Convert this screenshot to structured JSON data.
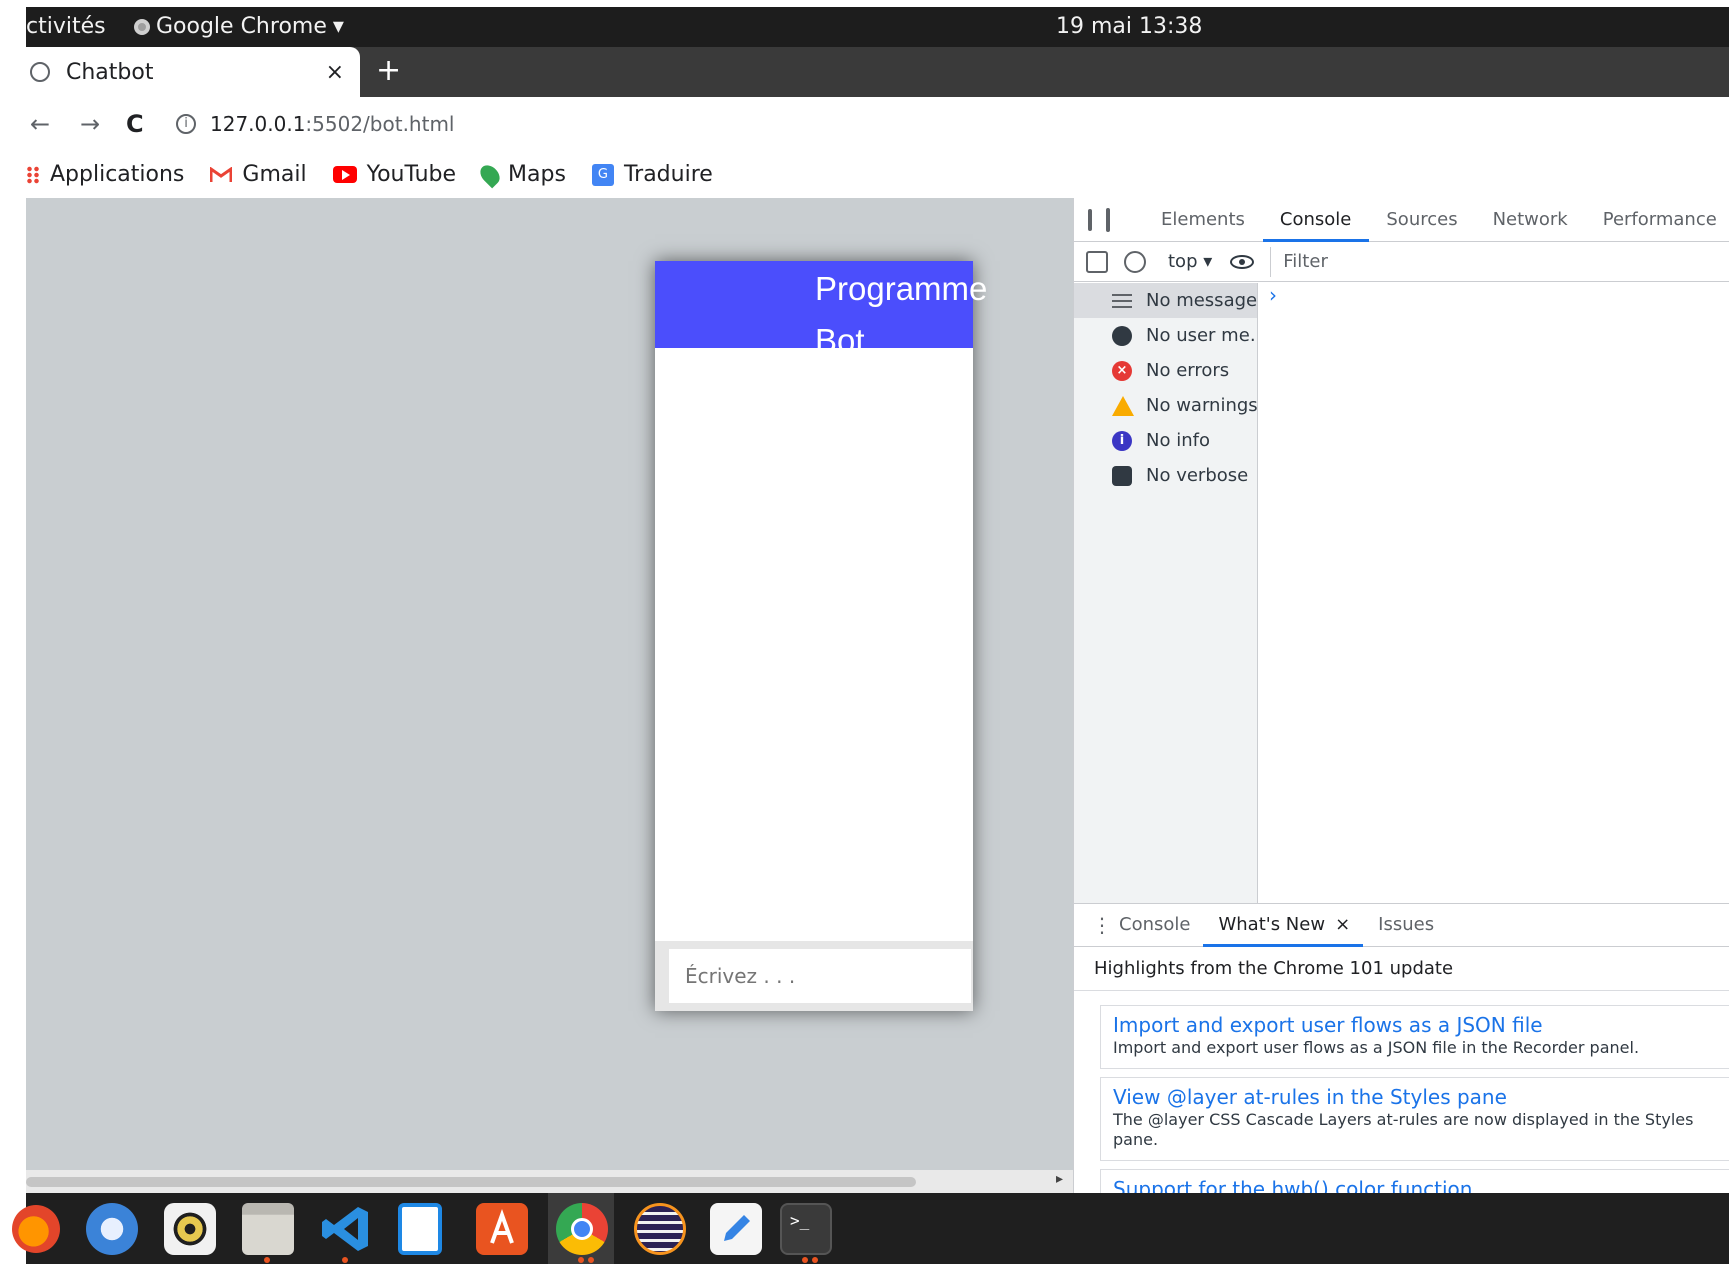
{
  "system_bar": {
    "activities": "ctivités",
    "app_name": "Google Chrome",
    "dropdown_glyph": "▾",
    "clock": "19 mai  13:38"
  },
  "browser": {
    "tab_title": "Chatbot",
    "tab_close": "×",
    "new_tab": "+",
    "nav_back": "←",
    "nav_forward": "→",
    "nav_reload": "C",
    "url_host": "127.0.0.1",
    "url_path": ":5502/bot.html",
    "bookmarks": [
      "Applications",
      "Gmail",
      "YouTube",
      "Maps",
      "Traduire"
    ]
  },
  "page": {
    "chat_title": "Programme Bot",
    "input_placeholder": "Écrivez . . .",
    "colors": {
      "header": "#4b4efc",
      "background": "#c9ced1"
    }
  },
  "devtools": {
    "tabs": [
      "Elements",
      "Console",
      "Sources",
      "Network",
      "Performance"
    ],
    "active_tab": "Console",
    "context": "top ▾",
    "filter_placeholder": "Filter",
    "sidebar": [
      {
        "label": "No messages",
        "icon": "list-icon"
      },
      {
        "label": "No user me…",
        "icon": "user-icon"
      },
      {
        "label": "No errors",
        "icon": "error-icon"
      },
      {
        "label": "No warnings",
        "icon": "warning-icon"
      },
      {
        "label": "No info",
        "icon": "info-icon"
      },
      {
        "label": "No verbose",
        "icon": "bug-icon"
      }
    ],
    "prompt": "›",
    "drawer_tabs": [
      "Console",
      "What's New",
      "Issues"
    ],
    "drawer_close": "×",
    "highlights_title": "Highlights from the Chrome 101 update",
    "whats_new": [
      {
        "title": "Import and export user flows as a JSON file",
        "desc": "Import and export user flows as a JSON file in the Recorder panel."
      },
      {
        "title": "View @layer at-rules in the Styles pane",
        "desc": "The @layer CSS Cascade Layers at-rules are now displayed in the Styles pane."
      },
      {
        "title": "Support for the hwb() color function",
        "desc": ""
      }
    ]
  },
  "dock": {
    "apps": [
      "firefox-icon",
      "thunderbird-icon",
      "rhythmbox-icon",
      "files-icon",
      "vscode-icon",
      "libreoffice-writer-icon",
      "software-icon",
      "chrome-icon",
      "eclipse-icon",
      "text-editor-icon",
      "terminal-icon"
    ]
  }
}
